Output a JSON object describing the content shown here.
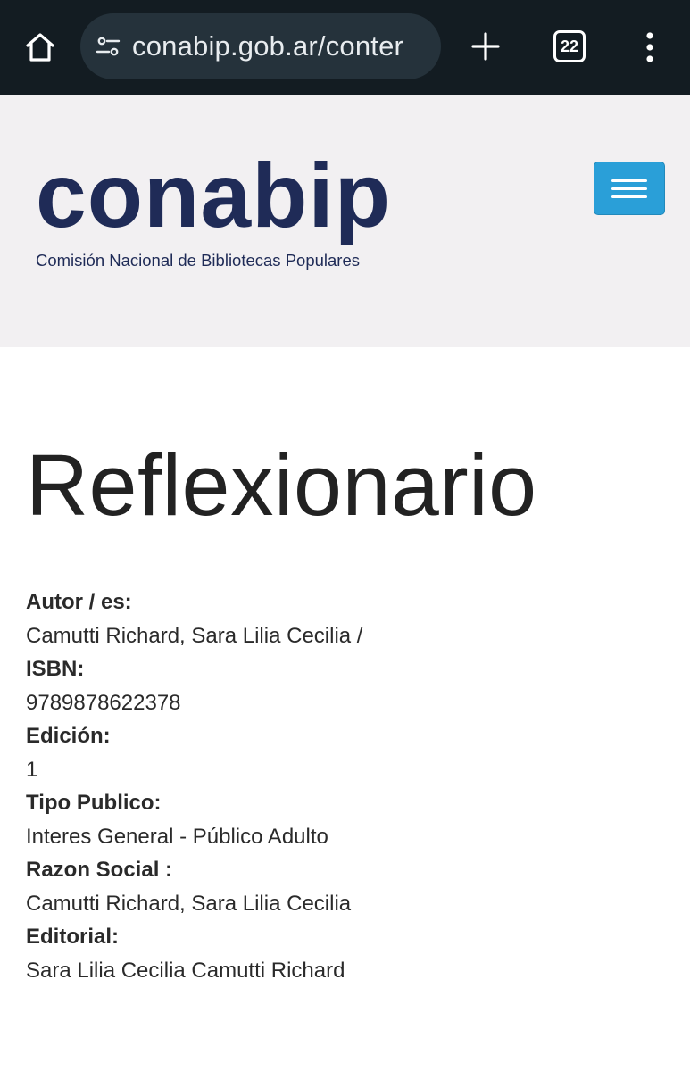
{
  "browser": {
    "url": "conabip.gob.ar/conter",
    "tab_count": "22",
    "home_icon": "home-icon",
    "site_settings_icon": "tune-icon",
    "new_tab_icon": "plus-icon",
    "menu_icon": "kebab-icon"
  },
  "header": {
    "logo_wordmark": "conabip",
    "logo_tagline": "Comisión Nacional de Bibliotecas Populares",
    "logo_color": "#1f2b57",
    "menu_button_color": "#2a9fd8"
  },
  "page": {
    "title": "Reflexionario",
    "fields": [
      {
        "label": "Autor / es:",
        "value": "Camutti Richard, Sara Lilia Cecilia /"
      },
      {
        "label": "ISBN:",
        "value": "9789878622378"
      },
      {
        "label": "Edición:",
        "value": "1"
      },
      {
        "label": "Tipo Publico:",
        "value": "Interes General - Público Adulto"
      },
      {
        "label": "Razon Social :",
        "value": "Camutti Richard, Sara Lilia Cecilia"
      },
      {
        "label": "Editorial:",
        "value": "Sara Lilia Cecilia Camutti Richard"
      }
    ]
  }
}
